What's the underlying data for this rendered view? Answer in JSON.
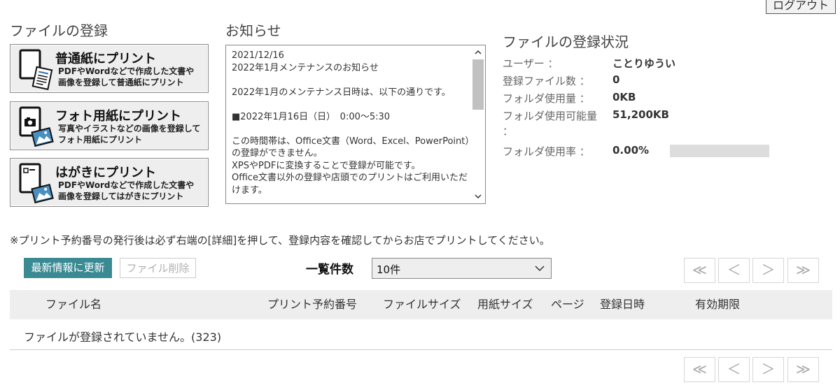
{
  "header": {
    "logout_label": "ログアウト"
  },
  "register": {
    "title": "ファイルの登録",
    "buttons": [
      {
        "title": "普通紙にプリント",
        "desc": "PDFやWordなどで作成した文書や\n画像を登録して普通紙にプリント"
      },
      {
        "title": "フォト用紙にプリント",
        "desc": "写真やイラストなどの画像を登録して\nフォト用紙にプリント"
      },
      {
        "title": "はがきにプリント",
        "desc": "PDFやWordなどで作成した文書や\n画像を登録してはがきにプリント"
      }
    ]
  },
  "notice": {
    "title": "お知らせ",
    "body": "2021/12/16\n2022年1月メンテナンスのお知らせ\n\n2022年1月のメンテナンス日時は、以下の通りです。\n\n■2022年1月16日（日）　0:00～5:30\n\nこの時間帯は、Office文書（Word、Excel、PowerPoint）の登録ができません。\nXPSやPDFに変換することで登録が可能です。\nOffice文書以外の登録や店頭でのプリントはご利用いただけます。"
  },
  "status": {
    "title": "ファイルの登録状況",
    "rows": [
      {
        "label": "ユーザー ：",
        "value": "ことりゆうい"
      },
      {
        "label": "登録ファイル数 ：",
        "value": "0"
      },
      {
        "label": "フォルダ使用量 ：",
        "value": "0KB"
      },
      {
        "label": "フォルダ使用可能量",
        "label_cont": "：",
        "value": "51,200KB"
      },
      {
        "label": "フォルダ使用率 ：",
        "value": "0.00%"
      }
    ],
    "usage_fraction": 0
  },
  "note": "※プリント予約番号の発行後は必ず右端の[詳細]を押して、登録内容を確認してからお店でプリントしてください。",
  "toolbar": {
    "refresh_label": "最新情報に更新",
    "delete_label": "ファイル削除",
    "count_label": "一覧件数",
    "count_selected": "10件"
  },
  "pager": {
    "first": "≪",
    "prev": "＜",
    "next": "＞",
    "last": "≫"
  },
  "table": {
    "columns": [
      "ファイル名",
      "プリント予約番号",
      "ファイルサイズ",
      "用紙サイズ",
      "ページ",
      "登録日時",
      "有効期限"
    ],
    "empty_message": "ファイルが登録されていません。(323)"
  },
  "colors": {
    "accent": "#3a8a94",
    "panel": "#eeeeee",
    "border": "#8a8a8a"
  },
  "icons": [
    "document-icon",
    "camera-icon",
    "postcard-icon",
    "photo-icon",
    "chevron-down-icon"
  ]
}
